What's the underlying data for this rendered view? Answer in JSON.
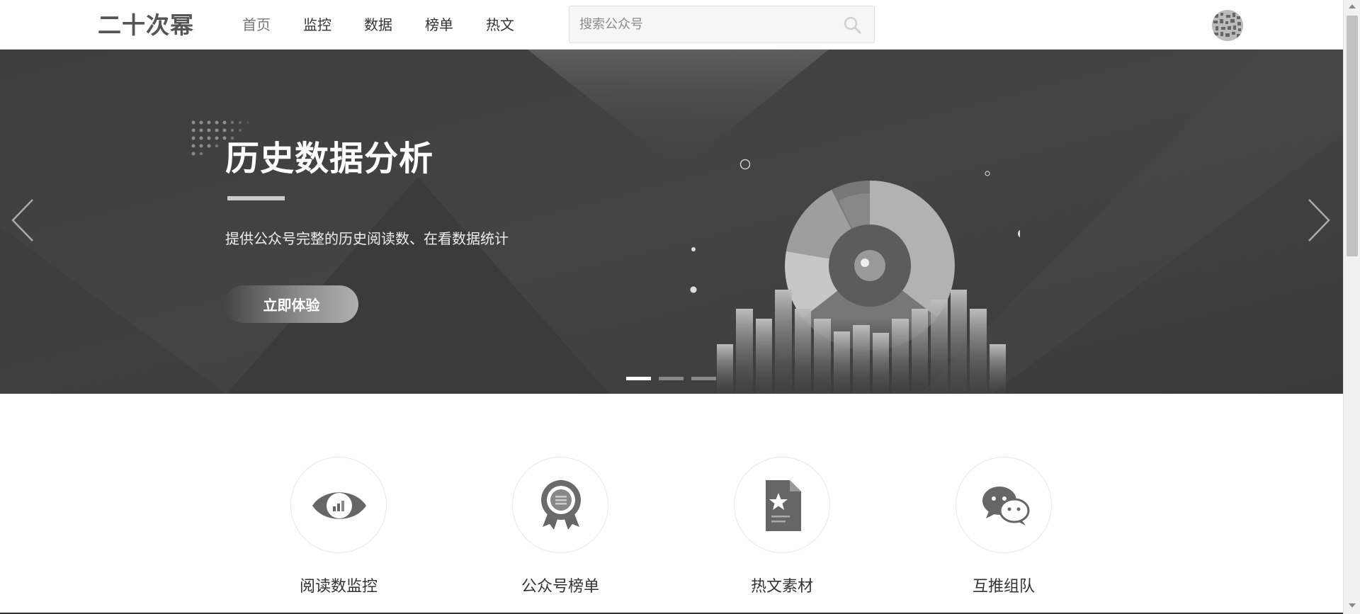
{
  "header": {
    "logo": "二十次幂",
    "nav": [
      {
        "label": "首页",
        "active": true
      },
      {
        "label": "监控",
        "active": false
      },
      {
        "label": "数据",
        "active": false
      },
      {
        "label": "榜单",
        "active": false
      },
      {
        "label": "热文",
        "active": false
      }
    ],
    "search": {
      "placeholder": "搜索公众号",
      "value": "",
      "icon": "search-icon"
    },
    "avatar": "avatar"
  },
  "banner": {
    "title": "历史数据分析",
    "subtitle": "提供公众号完整的历史阅读数、在看数据统计",
    "cta_label": "立即体验",
    "prev_icon": "chevron-left-icon",
    "next_icon": "chevron-right-icon",
    "slides_total": 3,
    "active_slide": 1
  },
  "features": [
    {
      "label": "阅读数监控",
      "icon": "eye-chart-icon"
    },
    {
      "label": "公众号榜单",
      "icon": "award-ribbon-icon"
    },
    {
      "label": "热文素材",
      "icon": "starred-document-icon"
    },
    {
      "label": "互推组队",
      "icon": "chat-bubbles-icon"
    }
  ],
  "colors": {
    "banner_bg": "#454545",
    "text_primary": "#333333",
    "accent_white": "#ffffff"
  }
}
